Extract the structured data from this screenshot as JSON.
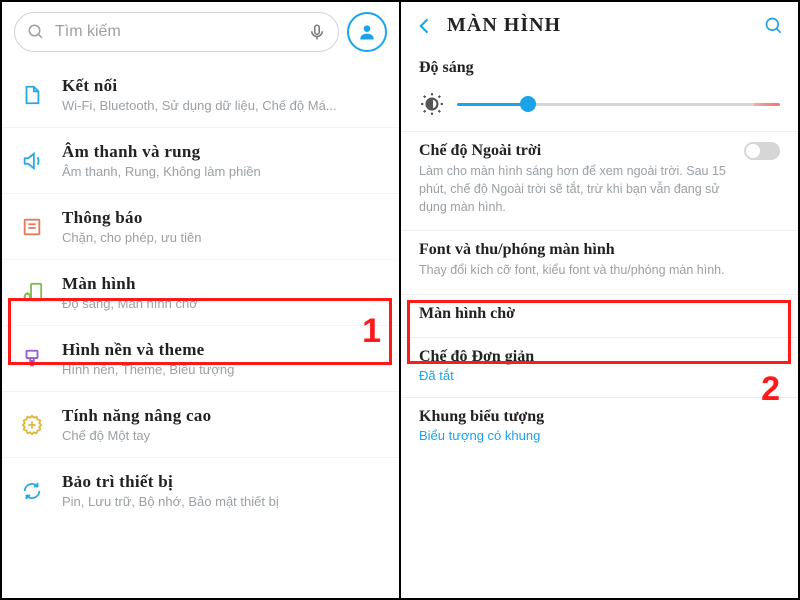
{
  "left": {
    "search_placeholder": "Tìm kiếm",
    "items": [
      {
        "icon": "wifi",
        "color": "#2aa9e0",
        "title": "Kết nối",
        "sub": "Wi-Fi, Bluetooth, Sử dụng dữ liệu, Chế độ Má..."
      },
      {
        "icon": "sound",
        "color": "#2aa9e0",
        "title": "Âm thanh và rung",
        "sub": "Âm thanh, Rung, Không làm phiền"
      },
      {
        "icon": "notif",
        "color": "#e57a5b",
        "title": "Thông báo",
        "sub": "Chặn, cho phép, ưu tiên"
      },
      {
        "icon": "display",
        "color": "#7cc04a",
        "title": "Màn hình",
        "sub": "Độ sáng, Màn hình chờ"
      },
      {
        "icon": "theme",
        "color": "#9b59d4",
        "title": "Hình nền và theme",
        "sub": "Hình nền, Theme, Biểu tượng"
      },
      {
        "icon": "advanced",
        "color": "#e0b73a",
        "title": "Tính năng nâng cao",
        "sub": "Chế độ Một tay"
      },
      {
        "icon": "device",
        "color": "#2aa9e0",
        "title": "Bảo trì thiết bị",
        "sub": "Pin, Lưu trữ, Bộ nhớ, Bảo mật thiết bị"
      }
    ],
    "marker": "1"
  },
  "right": {
    "header": "MÀN HÌNH",
    "brightness_label": "Độ sáng",
    "brightness_percent": 22,
    "outdoor": {
      "title": "Chế độ Ngoài trời",
      "sub": "Làm cho màn hình sáng hơn để xem ngoài trời. Sau 15 phút, chế độ Ngoài trời sẽ tắt, trừ khi bạn vẫn đang sử dụng màn hình.",
      "enabled": false
    },
    "font": {
      "title": "Font và thu/phóng màn hình",
      "sub": "Thay đổi kích cỡ font, kiểu font và thu/phóng màn hình."
    },
    "standby": {
      "title": "Màn hình chờ"
    },
    "simple": {
      "title": "Chế độ Đơn giản",
      "value": "Đã tắt"
    },
    "iconframe": {
      "title": "Khung biểu tượng",
      "value": "Biểu tượng có khung"
    },
    "marker": "2"
  }
}
